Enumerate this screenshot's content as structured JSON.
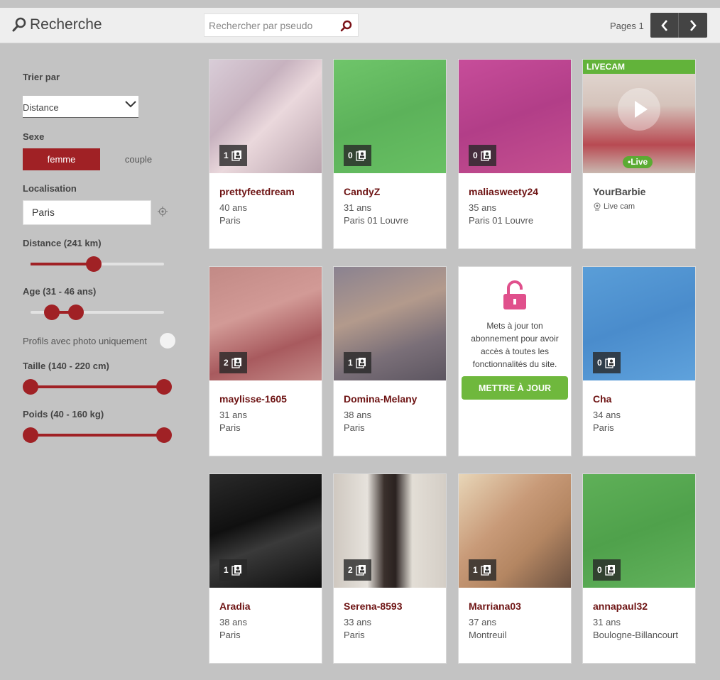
{
  "header": {
    "title": "Recherche",
    "search_placeholder": "Rechercher par pseudo",
    "pages_label": "Pages 1"
  },
  "filters": {
    "sort_label": "Trier par",
    "sort_value": "Distance",
    "sex_label": "Sexe",
    "sex_options": [
      "femme",
      "couple"
    ],
    "sex_selected": "femme",
    "location_label": "Localisation",
    "location_value": "Paris",
    "distance_label": "Distance (241 km)",
    "distance_value": 241,
    "age_label": "Age (31 - 46 ans)",
    "age_range": [
      31,
      46
    ],
    "photo_only_label": "Profils avec photo uniquement",
    "photo_only": false,
    "height_label": "Taille (140 - 220 cm)",
    "height_range": [
      140,
      220
    ],
    "weight_label": "Poids (40 - 160 kg)",
    "weight_range": [
      40,
      160
    ]
  },
  "colors": {
    "accent": "#a02125",
    "name": "#6e1414",
    "green": "#62b33a",
    "pink": "#e0508c"
  },
  "profiles": [
    {
      "name": "prettyfeetdream",
      "age": "40 ans",
      "city": "Paris",
      "photos": "1"
    },
    {
      "name": "CandyZ",
      "age": "31 ans",
      "city": "Paris 01 Louvre",
      "photos": "0"
    },
    {
      "name": "maliasweety24",
      "age": "35 ans",
      "city": "Paris 01 Louvre",
      "photos": "0"
    },
    {
      "name": "YourBarbie",
      "livecam": "LIVECAM",
      "live": "•Live",
      "cam": "Live cam"
    },
    {
      "name": "maylisse-1605",
      "age": "31 ans",
      "city": "Paris",
      "photos": "2"
    },
    {
      "name": "Domina-Melany",
      "age": "38 ans",
      "city": "Paris",
      "photos": "1"
    },
    {
      "upgrade_message": "Mets à jour ton abonnement pour avoir accès à toutes les fonctionnalités du site.",
      "upgrade_button": "METTRE À JOUR"
    },
    {
      "name": "Cha",
      "age": "34 ans",
      "city": "Paris",
      "photos": "0"
    },
    {
      "name": "Aradia",
      "age": "38 ans",
      "city": "Paris",
      "photos": "1"
    },
    {
      "name": "Serena-8593",
      "age": "33 ans",
      "city": "Paris",
      "photos": "2"
    },
    {
      "name": "Marriana03",
      "age": "37 ans",
      "city": "Montreuil",
      "photos": "1"
    },
    {
      "name": "annapaul32",
      "age": "31 ans",
      "city": "Boulogne-Billancourt",
      "photos": "0"
    }
  ]
}
